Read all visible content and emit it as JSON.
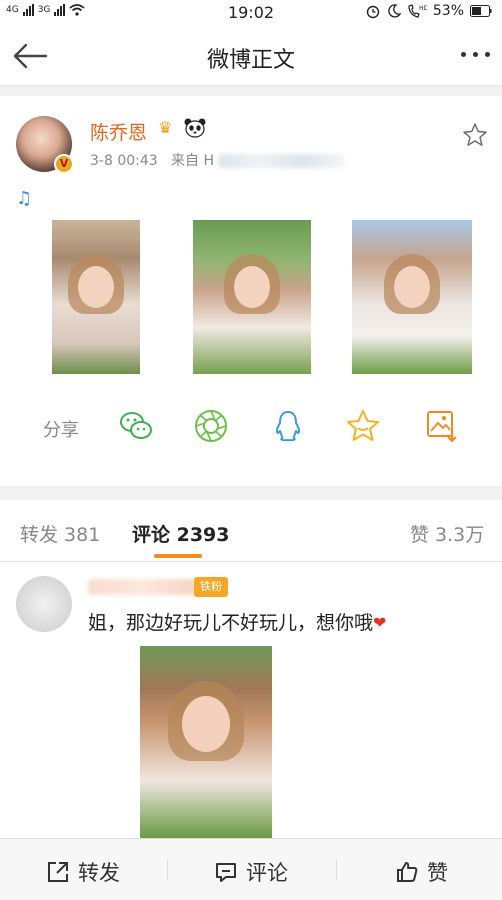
{
  "status_bar": {
    "left_labels": [
      "4G",
      "3G"
    ],
    "time": "19:02",
    "battery": "53%"
  },
  "nav": {
    "title": "微博正文"
  },
  "post": {
    "username": "陈乔恩",
    "crown": "♛",
    "verified_mark": "V",
    "timestamp": "3-8 00:43",
    "source_prefix": "来自 H",
    "music_glyph": "♫",
    "share_label": "分享"
  },
  "tabs": {
    "repost": "转发 381",
    "comments": "评论 2393",
    "likes": "赞 3.3万"
  },
  "comment": {
    "fan_badge": "铁粉",
    "text": "姐，那边好玩儿不好玩儿，想你哦",
    "heart": "❤"
  },
  "bottom_bar": {
    "repost": "转发",
    "comment": "评论",
    "like": "赞"
  },
  "colors": {
    "username": "#e8641b",
    "accent_underline": "#f28c1a",
    "wechat": "#3db24b",
    "moments": "#6cc04a",
    "qq": "#3b9ad9",
    "favorite": "#f5b41c",
    "save_image": "#f08a1c"
  }
}
